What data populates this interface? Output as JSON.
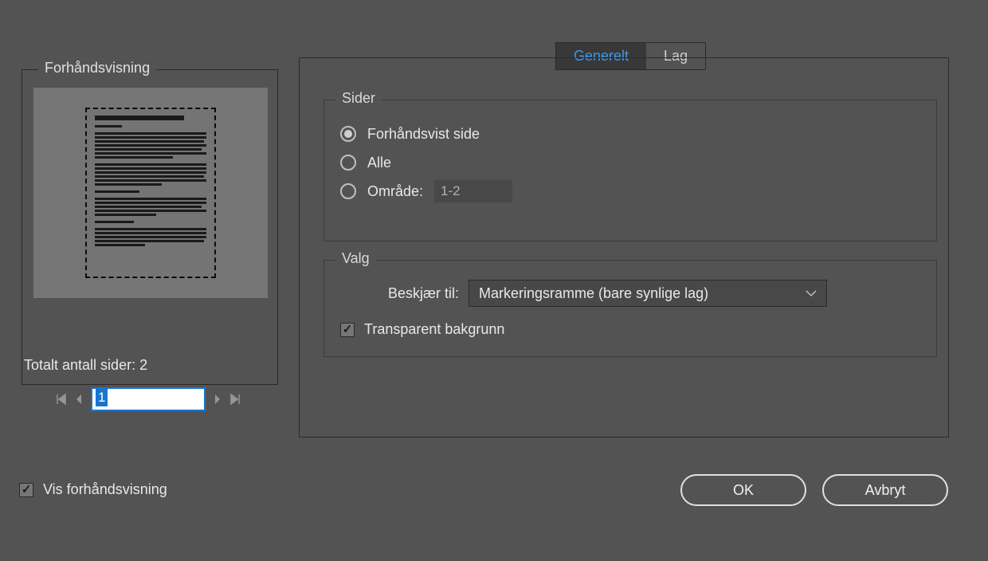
{
  "tabs": {
    "general": "Generelt",
    "lag": "Lag",
    "active": "general"
  },
  "pages": {
    "legend": "Sider",
    "previewed": "Forhåndsvist side",
    "all": "Alle",
    "range_label": "Område:",
    "range_value": "1-2",
    "selected": "previewed"
  },
  "options": {
    "legend": "Valg",
    "crop_label": "Beskjær til:",
    "crop_value": "Markeringsramme (bare synlige lag)",
    "transparent_bg": "Transparent bakgrunn",
    "transparent_checked": true
  },
  "preview": {
    "legend": "Forhåndsvisning",
    "page_value": "1",
    "total_label": "Totalt antall sider: 2"
  },
  "show_preview": {
    "label": "Vis forhåndsvisning",
    "checked": true
  },
  "buttons": {
    "ok": "OK",
    "cancel": "Avbryt"
  }
}
